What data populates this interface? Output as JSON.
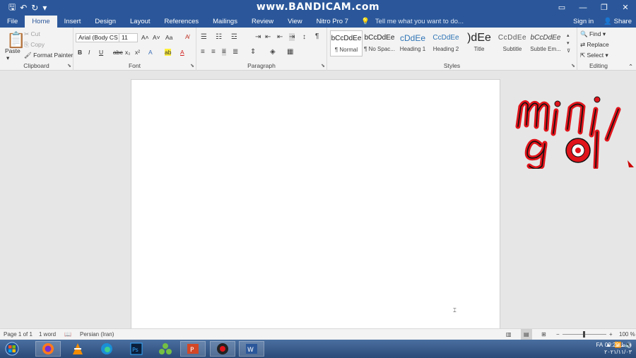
{
  "watermark": "www.BANDICAM.com",
  "quick_access": {
    "save": "🖫",
    "undo": "↶",
    "redo": "↻",
    "customize": "▾"
  },
  "window_controls": {
    "ribbon_display": "▭",
    "minimize": "—",
    "restore": "❐",
    "close": "✕"
  },
  "tabs": [
    {
      "label": "File"
    },
    {
      "label": "Home"
    },
    {
      "label": "Insert"
    },
    {
      "label": "Design"
    },
    {
      "label": "Layout"
    },
    {
      "label": "References"
    },
    {
      "label": "Mailings"
    },
    {
      "label": "Review"
    },
    {
      "label": "View"
    },
    {
      "label": "Nitro Pro 7"
    }
  ],
  "tell_me": "Tell me what you want to do...",
  "sign_in": "Sign in",
  "share": "Share",
  "clipboard": {
    "label": "Clipboard",
    "paste": "Paste",
    "cut": "Cut",
    "copy": "Copy",
    "format_painter": "Format Painter"
  },
  "font": {
    "label": "Font",
    "name": "Arial (Body CS",
    "size": "11",
    "grow": "A˄",
    "shrink": "A˅",
    "change_case": "Aa",
    "bold": "B",
    "italic": "I",
    "underline": "U",
    "strike": "abc",
    "subscript": "x₂",
    "superscript": "x²",
    "effects": "A",
    "highlight": "ab",
    "color": "A"
  },
  "paragraph": {
    "label": "Paragraph",
    "show_marks": "¶"
  },
  "styles": {
    "label": "Styles",
    "items": [
      {
        "preview": "bCcDdEe",
        "name": "¶ Normal"
      },
      {
        "preview": "bCcDdEe",
        "name": "¶ No Spac..."
      },
      {
        "preview": "cDdEe",
        "name": "Heading 1"
      },
      {
        "preview": "​CcDdEe",
        "name": "Heading 2"
      },
      {
        "preview": ")dEe",
        "name": "Title"
      },
      {
        "preview": "CcDdEe",
        "name": "Subtitle"
      },
      {
        "preview": "bCcDdEe",
        "name": "Subtle Em..."
      }
    ]
  },
  "editing": {
    "label": "Editing",
    "find": "Find",
    "replace": "Replace",
    "select": "Select"
  },
  "logo_text": "mini gol",
  "status": {
    "page": "Page 1 of 1",
    "words": "1 word",
    "language": "Persian (Iran)",
    "zoom": "100 %"
  },
  "tray": {
    "lang": "FA",
    "time": "09:29 ق.ظ",
    "date": "۲۰۲۱/۱۱/۰۳"
  },
  "colors": {
    "accent": "#2b579a",
    "logo_red": "#e0141b"
  }
}
